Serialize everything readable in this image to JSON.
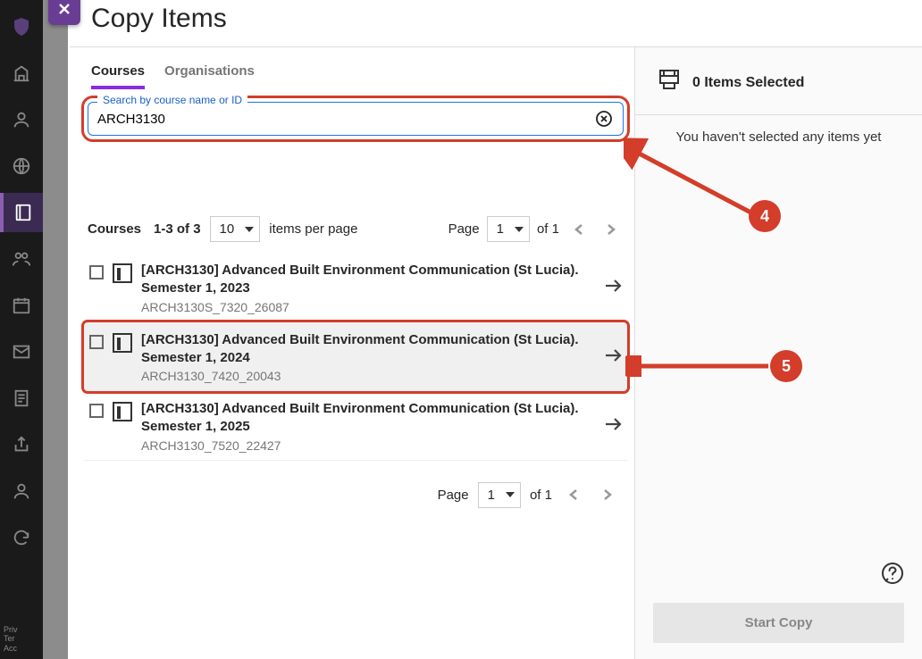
{
  "title": "Copy Items",
  "tabs": {
    "courses": "Courses",
    "organisations": "Organisations"
  },
  "search": {
    "legend": "Search by course name or ID",
    "value": "ARCH3130"
  },
  "list": {
    "label": "Courses",
    "range": "1-3 of 3",
    "page_size": "10",
    "per_page_label": "items per page",
    "page_label": "Page",
    "page_num": "1",
    "of_pages": "of 1"
  },
  "courses": [
    {
      "title": "[ARCH3130] Advanced Built Environment Communication (St Lucia). Semester 1, 2023",
      "id": "ARCH3130S_7320_26087"
    },
    {
      "title": "[ARCH3130] Advanced Built Environment Communication (St Lucia). Semester 1, 2024",
      "id": "ARCH3130_7420_20043"
    },
    {
      "title": "[ARCH3130] Advanced Built Environment Communication (St Lucia). Semester 1, 2025",
      "id": "ARCH3130_7520_22427"
    }
  ],
  "right": {
    "selected_count": "0 Items Selected",
    "empty_msg": "You haven't selected any items yet",
    "start_copy": "Start Copy"
  },
  "rail_footer": {
    "l1": "Priv",
    "l2": "Ter",
    "l3": "Acc"
  },
  "annotations": {
    "4": "4",
    "5": "5"
  }
}
